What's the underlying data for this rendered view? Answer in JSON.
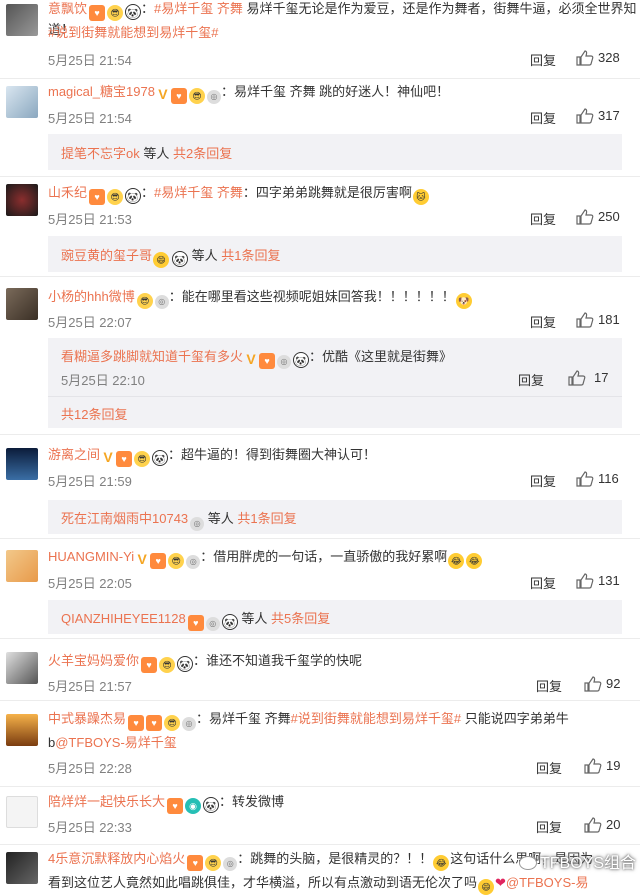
{
  "comments": [
    {
      "name": "意飘饮",
      "segments": [
        {
          "t": "#易烊千玺 齐舞",
          "topic": true
        },
        {
          "t": "易烊千玺无论是作为爱豆，还是作为舞者，街舞牛逼，必须全世界知道！",
          "topic": false
        },
        {
          "t": "#说到街舞就能想到易烊千玺#",
          "topic": true
        }
      ],
      "time": "5月25日 21:54",
      "reply": "回复",
      "likes": "328"
    },
    {
      "name": "magical_糖宝1978",
      "text": "：易烊千玺 齐舞 跳的好迷人！神仙吧！",
      "time": "5月25日 21:54",
      "reply": "回复",
      "likes": "317",
      "sub_user": "提笔不忘字ok",
      "sub_deng": "等人",
      "sub_more": "共2条回复"
    },
    {
      "name": "山禾纪",
      "topic": "#易烊千玺 齐舞",
      "text": "：四字弟弟跳舞就是很厉害啊",
      "time": "5月25日 21:53",
      "reply": "回复",
      "likes": "250",
      "sub_user": "豌豆黄的玺子哥",
      "sub_deng": "等人",
      "sub_more": "共1条回复"
    },
    {
      "name": "小杨的hhh微博",
      "text": "：能在哪里看这些视频呢姐妹回答我！！！！！！",
      "time": "5月25日 22:07",
      "reply": "回复",
      "likes": "181",
      "inner_name": "看糊逼多跳脚就知道千玺有多火",
      "inner_text": "：优酷《这里就是街舞》",
      "inner_time": "5月25日 22:10",
      "inner_reply": "回复",
      "inner_likes": "17",
      "sub_more": "共12条回复"
    },
    {
      "name": "游离之间",
      "text": "：超牛逼的！得到街舞圈大神认可！",
      "time": "5月25日 21:59",
      "reply": "回复",
      "likes": "116",
      "sub_user": "死在江南烟雨中10743",
      "sub_deng": "等人",
      "sub_more": "共1条回复"
    },
    {
      "name": "HUANGMIN-Yi",
      "text": "：借用胖虎的一句话，一直骄傲的我好累啊",
      "time": "5月25日 22:05",
      "reply": "回复",
      "likes": "131",
      "sub_user": "QIANZHIHEYEE1128",
      "sub_deng": "等人",
      "sub_more": "共5条回复"
    },
    {
      "name": "火羊宝妈妈爱你",
      "text": "：谁还不知道我千玺学的快呢",
      "time": "5月25日 21:57",
      "reply": "回复",
      "likes": "92"
    },
    {
      "name": "中式暴躁杰易",
      "text1": "：易烊千玺 齐舞",
      "topic": "#说到街舞就能想到易烊千玺#",
      "text2": "只能说四字弟弟牛",
      "line2": "b@TFBOYS-易烊千玺",
      "time": "5月25日 22:28",
      "reply": "回复",
      "likes": "19"
    },
    {
      "name": "陪烊烊一起快乐长大",
      "text": "：转发微博",
      "time": "5月25日 22:33",
      "reply": "回复",
      "likes": "20"
    },
    {
      "name": "4乐意沉默释放内心焰火",
      "text": "：跳舞的头脑，是很精灵的？！！",
      "text_b": "这句话什么思啊，是因为",
      "line2": "看到这位艺人竟然如此唱跳俱佳，才华横溢，所以有点激动到语无伦次了吗",
      "line2_mention": "@TFBOYS-易"
    }
  ],
  "watermark": "TFBOYS组合",
  "colors": {
    "accent": "#eb7350",
    "sub_bg": "#f2f2f5",
    "time": "#808080"
  }
}
